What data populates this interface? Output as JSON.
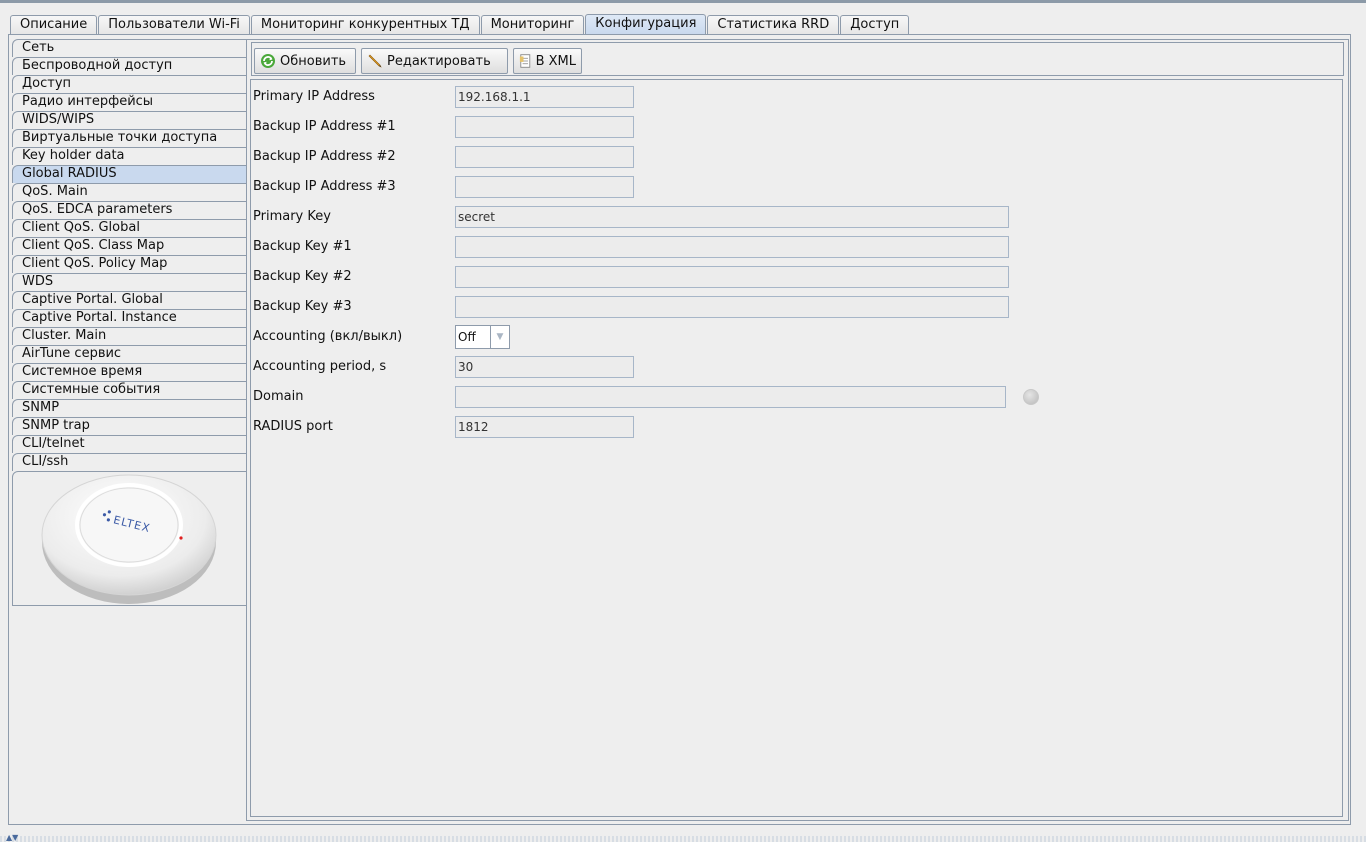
{
  "tabs": [
    {
      "label": "Описание",
      "active": false
    },
    {
      "label": "Пользователи Wi-Fi",
      "active": false
    },
    {
      "label": "Мониторинг конкурентных ТД",
      "active": false
    },
    {
      "label": "Мониторинг",
      "active": false
    },
    {
      "label": "Конфигурация",
      "active": true
    },
    {
      "label": "Статистика RRD",
      "active": false
    },
    {
      "label": "Доступ",
      "active": false
    }
  ],
  "sidebar": {
    "items": [
      "Сеть",
      "Беспроводной доступ",
      "Доступ",
      "Радио интерфейсы",
      "WIDS/WIPS",
      "Виртуальные точки доступа",
      "Key holder data",
      "Global RADIUS",
      "QoS. Main",
      "QoS. EDCA parameters",
      "Client QoS. Global",
      "Client QoS. Class Map",
      "Client QoS. Policy Map",
      "WDS",
      "Captive Portal. Global",
      "Captive Portal. Instance",
      "Cluster. Main",
      "AirTune сервис",
      "Системное время",
      "Системные события",
      "SNMP",
      "SNMP trap",
      "CLI/telnet",
      "CLI/ssh"
    ],
    "active_index": 7,
    "device_logo": "ELTEX"
  },
  "toolbar": {
    "refresh_label": "Обновить",
    "edit_label": "Редактировать",
    "xml_label": "В XML"
  },
  "form": {
    "fields": [
      {
        "label": "Primary IP Address",
        "value": "192.168.1.1"
      },
      {
        "label": "Backup IP Address #1",
        "value": ""
      },
      {
        "label": "Backup IP Address #2",
        "value": ""
      },
      {
        "label": "Backup IP Address #3",
        "value": ""
      },
      {
        "label": "Primary Key",
        "value": "secret"
      },
      {
        "label": "Backup Key #1",
        "value": ""
      },
      {
        "label": "Backup Key #2",
        "value": ""
      },
      {
        "label": "Backup Key #3",
        "value": ""
      },
      {
        "label": "Accounting (вкл/выкл)",
        "value": "Off"
      },
      {
        "label": "Accounting period, s",
        "value": "30"
      },
      {
        "label": "Domain",
        "value": ""
      },
      {
        "label": "RADIUS port",
        "value": "1812"
      }
    ]
  },
  "colors": {
    "border": "#8e9bab",
    "selected": "#c9d9ee",
    "background": "#eeeeee"
  }
}
